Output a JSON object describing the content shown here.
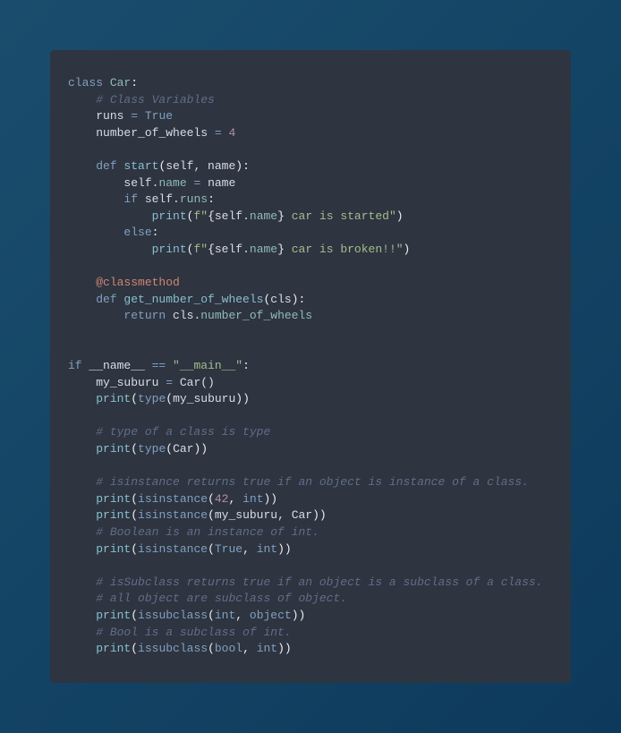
{
  "code": {
    "line1_class": "class",
    "line1_name": "Car",
    "line1_colon": ":",
    "line2_comment": "# Class Variables",
    "line3_var": "runs ",
    "line3_eq": "=",
    "line3_val": " True",
    "line4_var": "number_of_wheels ",
    "line4_eq": "=",
    "line4_val": " 4",
    "line6_def": "def",
    "line6_fn": " start",
    "line6_paren_o": "(",
    "line6_params": "self, name",
    "line6_paren_c": "):",
    "line7_self": "self.",
    "line7_name": "name",
    "line7_eq": " =",
    "line7_val": " name",
    "line8_if": "if",
    "line8_self": " self.",
    "line8_runs": "runs",
    "line8_colon": ":",
    "line9_print": "print",
    "line9_po": "(",
    "line9_f": "f\"",
    "line9_br": "{",
    "line9_self": "self.",
    "line9_name": "name",
    "line9_brc": "}",
    "line9_str": " car is started\"",
    "line9_pc": ")",
    "line10_else": "else",
    "line10_colon": ":",
    "line11_print": "print",
    "line11_po": "(",
    "line11_f": "f\"",
    "line11_br": "{",
    "line11_self": "self.",
    "line11_name": "name",
    "line11_brc": "}",
    "line11_str": " car is broken!!\"",
    "line11_pc": ")",
    "line13_deco": "@classmethod",
    "line14_def": "def",
    "line14_fn": " get_number_of_wheels",
    "line14_po": "(",
    "line14_params": "cls",
    "line14_pc": "):",
    "line15_return": "return",
    "line15_cls": " cls.",
    "line15_prop": "number_of_wheels",
    "line18_if": "if",
    "line18_name": " __name__ ",
    "line18_eq": "==",
    "line18_str": " \"__main__\"",
    "line18_colon": ":",
    "line19_var": "my_suburu ",
    "line19_eq": "=",
    "line19_call": " Car()",
    "line20_print": "print",
    "line20_po": "(",
    "line20_type": "type",
    "line20_po2": "(",
    "line20_arg": "my_suburu",
    "line20_pc": "))",
    "line22_comment": "# type of a class is type",
    "line23_print": "print",
    "line23_po": "(",
    "line23_type": "type",
    "line23_po2": "(",
    "line23_arg": "Car",
    "line23_pc": "))",
    "line25_comment": "# isinstance returns true if an object is instance of a class.",
    "line26_print": "print",
    "line26_po": "(",
    "line26_isi": "isinstance",
    "line26_po2": "(",
    "line26_num": "42",
    "line26_comma": ", ",
    "line26_int": "int",
    "line26_pc": "))",
    "line27_print": "print",
    "line27_po": "(",
    "line27_isi": "isinstance",
    "line27_po2": "(",
    "line27_arg": "my_suburu, Car",
    "line27_pc": "))",
    "line28_comment": "# Boolean is an instance of int.",
    "line29_print": "print",
    "line29_po": "(",
    "line29_isi": "isinstance",
    "line29_po2": "(",
    "line29_true": "True",
    "line29_comma": ", ",
    "line29_int": "int",
    "line29_pc": "))",
    "line31_comment": "# isSubclass returns true if an object is a subclass of a class.",
    "line32_comment": "# all object are subclass of object.",
    "line33_print": "print",
    "line33_po": "(",
    "line33_iss": "issubclass",
    "line33_po2": "(",
    "line33_int": "int",
    "line33_comma": ", ",
    "line33_obj": "object",
    "line33_pc": "))",
    "line34_comment": "# Bool is a subclass of int.",
    "line35_print": "print",
    "line35_po": "(",
    "line35_iss": "issubclass",
    "line35_po2": "(",
    "line35_bool": "bool",
    "line35_comma": ", ",
    "line35_int": "int",
    "line35_pc": "))"
  }
}
